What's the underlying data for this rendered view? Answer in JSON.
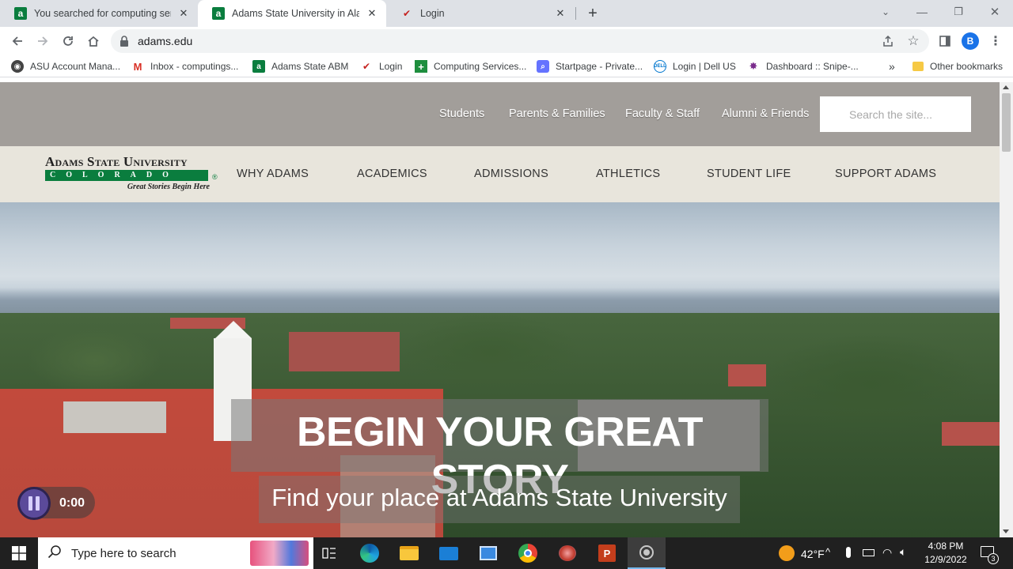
{
  "browser": {
    "tabs": [
      {
        "title": "You searched for computing serv",
        "active": false
      },
      {
        "title": "Adams State University in Alamo",
        "active": true
      },
      {
        "title": "Login",
        "active": false
      }
    ],
    "url": "adams.edu",
    "profile_initial": "B",
    "bookmarks": [
      {
        "label": "ASU Account Mana...",
        "icon": "asu-seal-icon"
      },
      {
        "label": "Inbox - computings...",
        "icon": "gmail-icon"
      },
      {
        "label": "Adams State ABM",
        "icon": "adams-a-icon"
      },
      {
        "label": "Login",
        "icon": "checkmark-icon"
      },
      {
        "label": "Computing Services...",
        "icon": "green-plus-icon"
      },
      {
        "label": "Startpage - Private...",
        "icon": "startpage-icon"
      },
      {
        "label": "Login | Dell US",
        "icon": "dell-icon"
      },
      {
        "label": "Dashboard :: Snipe-...",
        "icon": "snipe-icon"
      }
    ],
    "more_bookmarks": "»",
    "other_bookmarks": "Other bookmarks"
  },
  "site": {
    "utility_links": [
      "Students",
      "Parents & Families",
      "Faculty & Staff",
      "Alumni & Friends"
    ],
    "search_placeholder": "Search the site...",
    "logo": {
      "line1": "Adams State University",
      "line2": "COLORADO",
      "tagline": "Great Stories Begin Here"
    },
    "nav": [
      "WHY ADAMS",
      "ACADEMICS",
      "ADMISSIONS",
      "ATHLETICS",
      "STUDENT LIFE",
      "SUPPORT ADAMS"
    ],
    "hero": {
      "headline": "BEGIN YOUR GREAT STORY",
      "subline": "Find your place at Adams State University",
      "video_time": "0:00"
    }
  },
  "taskbar": {
    "search_placeholder": "Type here to search",
    "weather": "42°F",
    "time": "4:08 PM",
    "date": "12/9/2022",
    "notification_count": "3"
  },
  "colors": {
    "utility_bar": "#a29e9a",
    "nav_bar": "#e8e5dc",
    "logo_green": "#0a7d3e"
  }
}
